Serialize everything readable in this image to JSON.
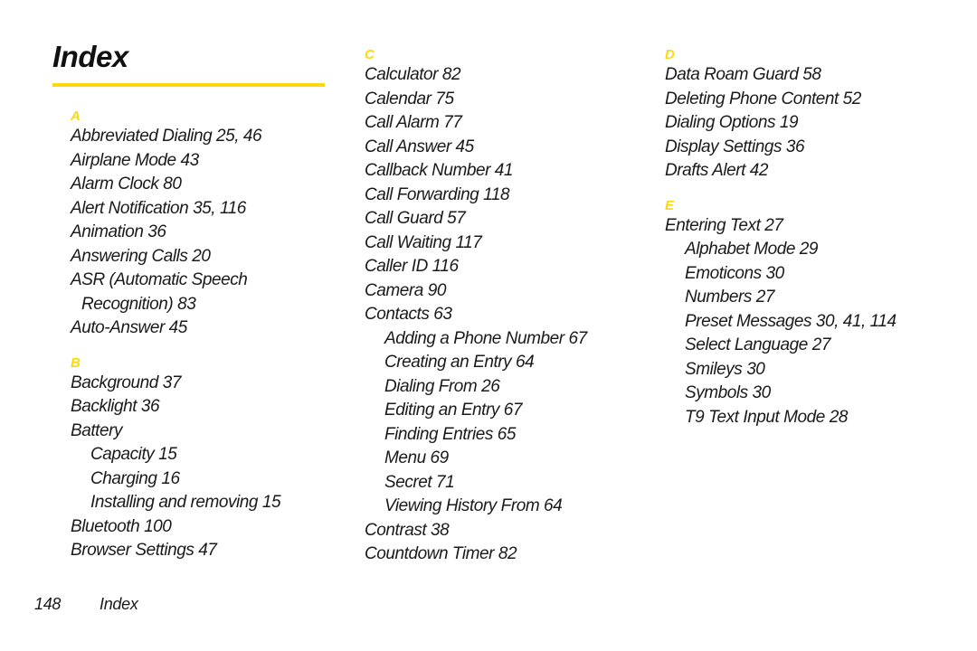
{
  "page": {
    "title": "Index",
    "accent_color": "#FBD90D",
    "text_color": "#1a1a1a",
    "background_color": "#ffffff"
  },
  "footer": {
    "page_number": "148",
    "label": "Index"
  },
  "columns": [
    {
      "id": "column-1",
      "sections": [
        {
          "letter": "A",
          "entries": [
            {
              "text": "Abbreviated Dialing 25, 46",
              "level": 0
            },
            {
              "text": "Airplane Mode 43",
              "level": 0
            },
            {
              "text": "Alarm Clock 80",
              "level": 0
            },
            {
              "text": "Alert Notification 35, 116",
              "level": 0
            },
            {
              "text": "Animation 36",
              "level": 0
            },
            {
              "text": "Answering Calls 20",
              "level": 0
            },
            {
              "text": "ASR (Automatic Speech",
              "level": 0
            },
            {
              "text": "Recognition) 83",
              "level": 2
            },
            {
              "text": "Auto-Answer 45",
              "level": 0
            }
          ]
        },
        {
          "letter": "B",
          "entries": [
            {
              "text": "Background 37",
              "level": 0
            },
            {
              "text": "Backlight 36",
              "level": 0
            },
            {
              "text": "Battery",
              "level": 0
            },
            {
              "text": "Capacity 15",
              "level": 1
            },
            {
              "text": "Charging 16",
              "level": 1
            },
            {
              "text": "Installing and removing 15",
              "level": 1
            },
            {
              "text": "Bluetooth 100",
              "level": 0
            },
            {
              "text": "Browser Settings 47",
              "level": 0
            }
          ]
        }
      ]
    },
    {
      "id": "column-2",
      "sections": [
        {
          "letter": "C",
          "entries": [
            {
              "text": "Calculator 82",
              "level": 0
            },
            {
              "text": "Calendar 75",
              "level": 0
            },
            {
              "text": "Call Alarm 77",
              "level": 0
            },
            {
              "text": "Call Answer 45",
              "level": 0
            },
            {
              "text": "Callback Number 41",
              "level": 0
            },
            {
              "text": "Call Forwarding 118",
              "level": 0
            },
            {
              "text": "Call Guard 57",
              "level": 0
            },
            {
              "text": "Call Waiting 117",
              "level": 0
            },
            {
              "text": "Caller ID 116",
              "level": 0
            },
            {
              "text": "Camera 90",
              "level": 0
            },
            {
              "text": "Contacts 63",
              "level": 0
            },
            {
              "text": "Adding a Phone Number 67",
              "level": 1
            },
            {
              "text": "Creating an Entry 64",
              "level": 1
            },
            {
              "text": "Dialing From 26",
              "level": 1
            },
            {
              "text": "Editing an Entry 67",
              "level": 1
            },
            {
              "text": "Finding Entries 65",
              "level": 1
            },
            {
              "text": "Menu 69",
              "level": 1
            },
            {
              "text": "Secret 71",
              "level": 1
            },
            {
              "text": "Viewing History From 64",
              "level": 1
            },
            {
              "text": "Contrast 38",
              "level": 0
            },
            {
              "text": "Countdown Timer 82",
              "level": 0
            }
          ]
        }
      ]
    },
    {
      "id": "column-3",
      "sections": [
        {
          "letter": "D",
          "entries": [
            {
              "text": "Data Roam Guard 58",
              "level": 0
            },
            {
              "text": "Deleting Phone Content 52",
              "level": 0
            },
            {
              "text": "Dialing Options 19",
              "level": 0
            },
            {
              "text": "Display Settings 36",
              "level": 0
            },
            {
              "text": "Drafts Alert 42",
              "level": 0
            }
          ]
        },
        {
          "letter": "E",
          "entries": [
            {
              "text": "Entering Text 27",
              "level": 0
            },
            {
              "text": "Alphabet Mode 29",
              "level": 1
            },
            {
              "text": "Emoticons 30",
              "level": 1
            },
            {
              "text": "Numbers 27",
              "level": 1
            },
            {
              "text": "Preset Messages 30, 41, 114",
              "level": 1
            },
            {
              "text": "Select Language 27",
              "level": 1
            },
            {
              "text": "Smileys 30",
              "level": 1
            },
            {
              "text": "Symbols 30",
              "level": 1
            },
            {
              "text": "T9 Text Input Mode 28",
              "level": 1
            }
          ]
        }
      ]
    }
  ]
}
